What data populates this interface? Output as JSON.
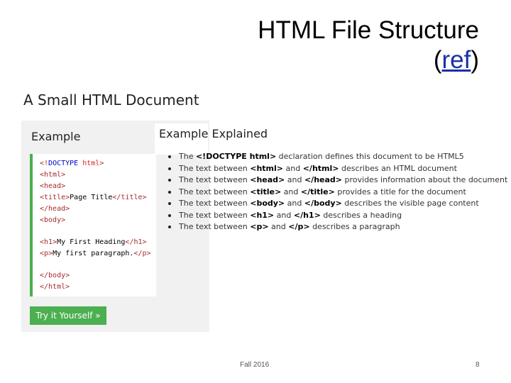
{
  "slide": {
    "title_line1": "HTML File Structure",
    "title_open_paren": "(",
    "title_link": "ref",
    "title_close_paren": ")"
  },
  "screenshot": {
    "heading": "A Small HTML Document",
    "example_label": "Example",
    "try_button": "Try it Yourself »",
    "explained_heading": "Example Explained",
    "code": {
      "l1_lt": "<!",
      "l1_kw": "DOCTYPE",
      "l1_val": " html",
      "l1_gt": ">",
      "l2": "<html>",
      "l3": "<head>",
      "l4_open": "<title>",
      "l4_text": "Page Title",
      "l4_close": "</title>",
      "l5": "</head>",
      "l6": "<body>",
      "l7_open": "<h1>",
      "l7_text": "My First Heading",
      "l7_close": "</h1>",
      "l8_open": "<p>",
      "l8_text": "My first paragraph.",
      "l8_close": "</p>",
      "l9": "</body>",
      "l10": "</html>"
    },
    "bullets": [
      {
        "p1": "The ",
        "b1": "<!DOCTYPE html>",
        "p2": " declaration defines this document to be HTML5",
        "b2": "",
        "p3": ""
      },
      {
        "p1": "The text between ",
        "b1": "<html>",
        "p2": " and ",
        "b2": "</html>",
        "p3": " describes an HTML document"
      },
      {
        "p1": "The text between ",
        "b1": "<head>",
        "p2": " and ",
        "b2": "</head>",
        "p3": " provides information about the document"
      },
      {
        "p1": "The text between ",
        "b1": "<title>",
        "p2": " and ",
        "b2": "</title>",
        "p3": " provides a title for the document"
      },
      {
        "p1": "The text between ",
        "b1": "<body>",
        "p2": " and ",
        "b2": "</body>",
        "p3": " describes the visible page content"
      },
      {
        "p1": "The text between ",
        "b1": "<h1>",
        "p2": " and ",
        "b2": "</h1>",
        "p3": " describes a heading"
      },
      {
        "p1": "The text between ",
        "b1": "<p>",
        "p2": " and ",
        "b2": "</p>",
        "p3": " describes a paragraph"
      }
    ]
  },
  "footer": {
    "date": "Fall 2016",
    "page": "8"
  },
  "colors": {
    "accent_green": "#4caf50",
    "link_blue": "#1a2fa8",
    "panel_gray": "#f1f1f1"
  }
}
